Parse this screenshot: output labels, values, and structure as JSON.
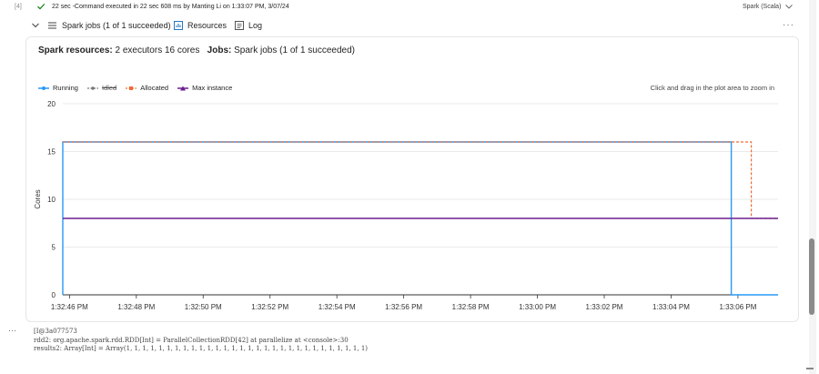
{
  "cell": {
    "index": "[4]",
    "status_text": "22 sec -Command executed in 22 sec 608 ms by Manting Li on 1:33:07 PM, 3/07/24",
    "language": "Spark (Scala)"
  },
  "job_bar": {
    "jobs_label": "Spark jobs (1 of 1 succeeded)",
    "resources_label": "Resources",
    "log_label": "Log"
  },
  "resources": {
    "res_key": "Spark resources:",
    "res_value": "2 executors 16 cores",
    "jobs_key": "Jobs:",
    "jobs_value": "Spark jobs (1 of 1 succeeded)"
  },
  "legend": {
    "running": "Running",
    "idled": "Idled",
    "allocated": "Allocated",
    "max_instance": "Max instance"
  },
  "zoom_hint": "Click and drag in the plot area to zoom in",
  "colors": {
    "running": "#2899f5",
    "idled": "#767676",
    "allocated": "#f06a35",
    "max_instance": "#6b1f8f"
  },
  "chart_data": {
    "type": "line",
    "ylabel": "Cores",
    "ylim": [
      0,
      20
    ],
    "yticks": [
      0,
      5,
      10,
      15,
      20
    ],
    "xticks": [
      "1:32:46 PM",
      "1:32:48 PM",
      "1:32:50 PM",
      "1:32:52 PM",
      "1:32:54 PM",
      "1:32:56 PM",
      "1:32:58 PM",
      "1:33:00 PM",
      "1:33:02 PM",
      "1:33:04 PM",
      "1:33:06 PM"
    ],
    "x_range": [
      "1:32:45.8 PM",
      "1:33:07.2 PM"
    ],
    "series": [
      {
        "name": "Running",
        "points": [
          [
            "1:32:45.8 PM",
            0
          ],
          [
            "1:32:45.8 PM",
            16
          ],
          [
            "1:33:05.8 PM",
            16
          ],
          [
            "1:33:05.8 PM",
            0
          ],
          [
            "1:33:07.2 PM",
            0
          ]
        ]
      },
      {
        "name": "Idled",
        "points": []
      },
      {
        "name": "Allocated",
        "points": [
          [
            "1:32:45.8 PM",
            16
          ],
          [
            "1:33:06.4 PM",
            16
          ],
          [
            "1:33:06.4 PM",
            8
          ],
          [
            "1:33:07.2 PM",
            8
          ]
        ]
      },
      {
        "name": "Max instance",
        "points": [
          [
            "1:32:45.8 PM",
            8
          ],
          [
            "1:33:07.2 PM",
            8
          ]
        ]
      }
    ]
  },
  "output": {
    "line1": "[I@3a077573",
    "line2": "rdd2: org.apache.spark.rdd.RDD[Int] = ParallelCollectionRDD[42] at parallelize at <console>:30",
    "line3": "results2: Array[Int] = Array(1, 1, 1, 1, 1, 1, 1, 1, 1, 1, 1, 1, 1, 1, 1, 1, 1, 1, 1, 1, 1, 1, 1, 1, 1, 1, 1, 1, 1, 1)"
  }
}
